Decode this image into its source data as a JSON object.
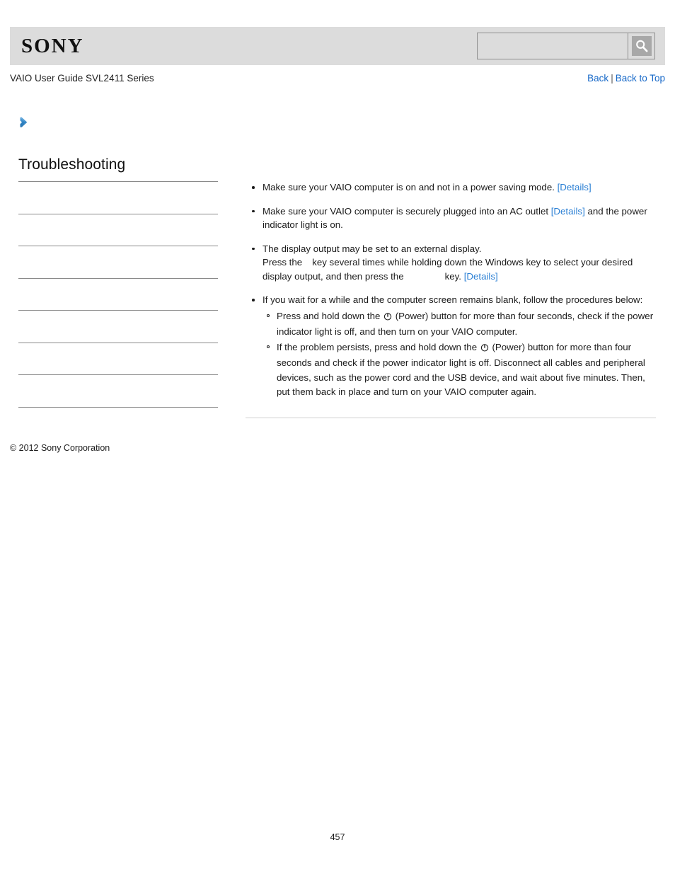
{
  "header": {
    "logo_text": "SONY",
    "search": {
      "value": "",
      "placeholder": "",
      "icon": "search-icon",
      "button_label": ""
    }
  },
  "subheader": {
    "guide_title": "VAIO User Guide SVL2411 Series",
    "back_label": "Back",
    "separator": "|",
    "back_to_top_label": "Back to Top"
  },
  "breadcrumb_icon": "chevron-right-icon",
  "accent_colors": {
    "link_blue": "#1668c8",
    "details_blue": "#2a7fd4",
    "arrow_blue": "#3d92ce",
    "header_gray": "#dcdcdc",
    "rule_gray": "#8a8a8a"
  },
  "sidebar": {
    "title": "Troubleshooting",
    "items": [
      {
        "label": ""
      },
      {
        "label": ""
      },
      {
        "label": ""
      },
      {
        "label": ""
      },
      {
        "label": ""
      },
      {
        "label": ""
      },
      {
        "label": ""
      }
    ]
  },
  "main": {
    "bullets": [
      {
        "id": "power-saving",
        "text_before": "Make sure your VAIO computer is on and not in a power saving mode. ",
        "link": "[Details]",
        "text_after": ""
      },
      {
        "id": "ac-outlet",
        "text_before": "Make sure your VAIO computer is securely plugged into an AC outlet ",
        "link": "[Details]",
        "text_after": " and the power indicator light is on."
      },
      {
        "id": "display-output",
        "line1": "The display output may be set to an external display.",
        "line2_a": "Press the",
        "line2_b": "key several times while holding down the Windows key to select your desired display output, and then press the",
        "line2_c": "key. ",
        "link": "[Details]"
      },
      {
        "id": "blank-screen",
        "text": "If you wait for a while and the computer screen remains blank, follow the procedures below:",
        "sub_bullets": [
          {
            "id": "hold-power",
            "part1": "Press and hold down the ",
            "icon": "power-icon",
            "part2": " (Power) button for more than four seconds, check if the power indicator light is off, and then turn on your VAIO computer."
          },
          {
            "id": "problem-persists",
            "part1": "If the problem persists, press and hold down the ",
            "icon": "power-icon",
            "part2": " (Power) button for more than four seconds and check if the power indicator light is off. Disconnect all cables and peripheral devices, such as the power cord and the USB device, and wait about five minutes. Then, put them back in place and turn on your VAIO computer again."
          }
        ]
      }
    ]
  },
  "footer": {
    "copyright": "© 2012 Sony Corporation",
    "page_number": "457"
  }
}
